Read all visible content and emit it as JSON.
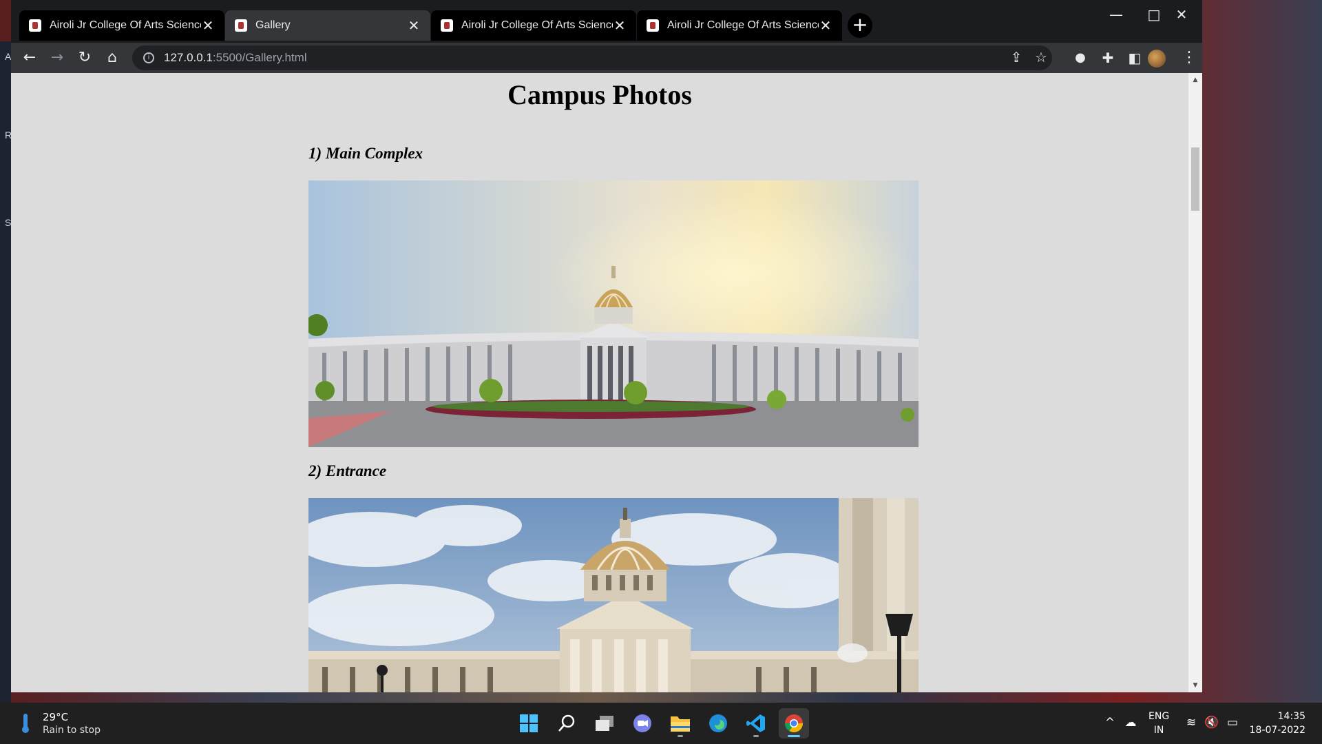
{
  "desktop": {
    "edge_letters": [
      "A",
      "R",
      "S"
    ]
  },
  "browser": {
    "tabs": [
      {
        "title": "Airoli Jr College Of Arts Science /",
        "close": "✕"
      },
      {
        "title": "Gallery",
        "close": "✕"
      },
      {
        "title": "Airoli Jr College Of Arts Science /",
        "close": "✕"
      },
      {
        "title": "Airoli Jr College Of Arts Science /",
        "close": "✕"
      }
    ],
    "active_tab_index": 1,
    "new_tab_label": "+",
    "window_controls": {
      "minimize": "—",
      "maximize": "□",
      "close": "✕"
    },
    "toolbar": {
      "back": "←",
      "forward": "→",
      "reload": "↻",
      "home": "⌂",
      "menu": "⋮"
    },
    "address": {
      "host": "127.0.0.1",
      "path": ":5500/Gallery.html"
    },
    "icons": [
      "share-icon",
      "bookmark-star-icon",
      "extension-circle-icon",
      "puzzle-extensions-icon",
      "side-panel-icon",
      "profile-avatar"
    ]
  },
  "page": {
    "title": "Campus Photos",
    "sections": [
      {
        "heading": "1) Main Complex",
        "photo": "main-complex-building-with-golden-dome"
      },
      {
        "heading": "2) Entrance",
        "photo": "entrance-dome-and-portico-with-clouds"
      }
    ],
    "scrollbar": {
      "up": "▲",
      "down": "▼"
    }
  },
  "taskbar": {
    "weather": {
      "temp": "29°C",
      "condition": "Rain to stop"
    },
    "apps": [
      "start-icon",
      "search-icon",
      "task-view-icon",
      "teams-chat-icon",
      "file-explorer-icon",
      "edge-icon",
      "vscode-icon",
      "chrome-icon"
    ],
    "active_app": "chrome-icon",
    "language": {
      "line1": "ENG",
      "line2": "IN"
    },
    "clock": {
      "time": "14:35",
      "date": "18-07-2022"
    },
    "tray_arrow": "^"
  }
}
